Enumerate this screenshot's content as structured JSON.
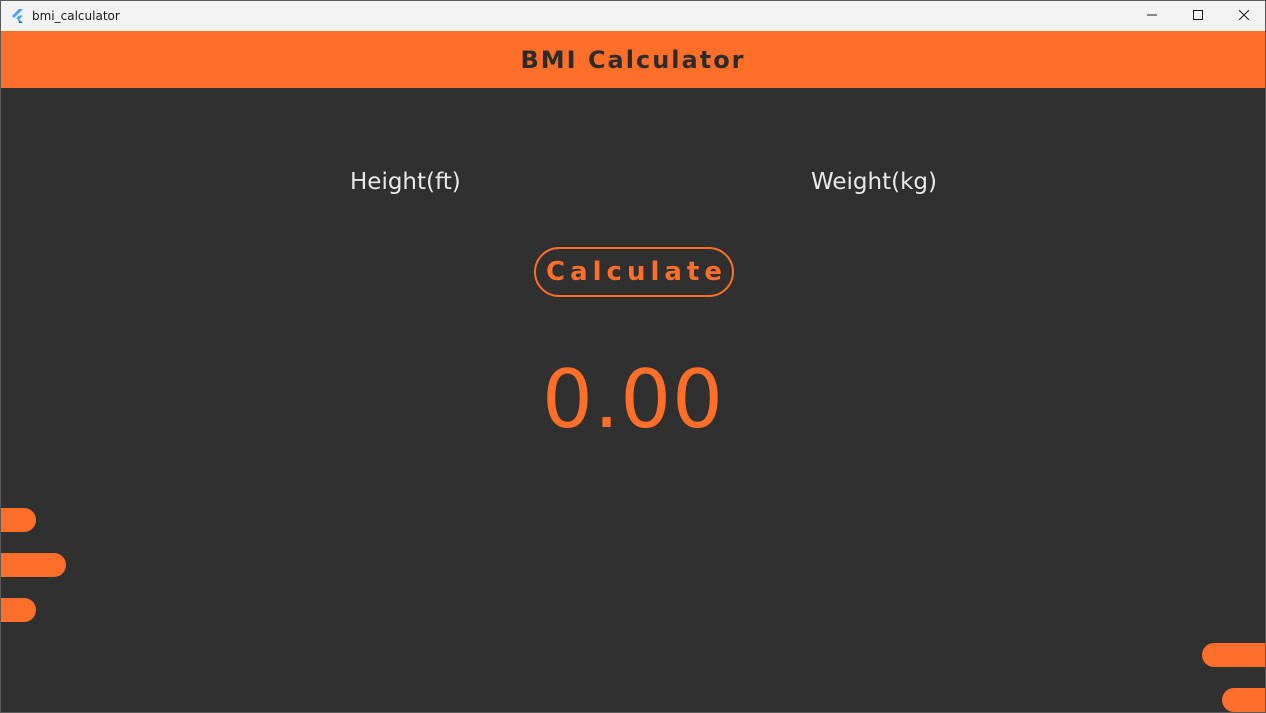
{
  "window": {
    "title": "bmi_calculator"
  },
  "appbar": {
    "title": "BMI Calculator"
  },
  "form": {
    "height_label": "Height(ft)",
    "weight_label": "Weight(kg)",
    "calculate_label": "Calculate"
  },
  "result": {
    "value": "0.00"
  },
  "colors": {
    "accent": "#ff6f2a",
    "background": "#303030",
    "appbar_text": "#2c2c2c",
    "label_text": "#e8e8e8"
  },
  "icons": {
    "app": "flutter-icon",
    "minimize": "minimize-icon",
    "maximize": "maximize-icon",
    "close": "close-icon"
  }
}
